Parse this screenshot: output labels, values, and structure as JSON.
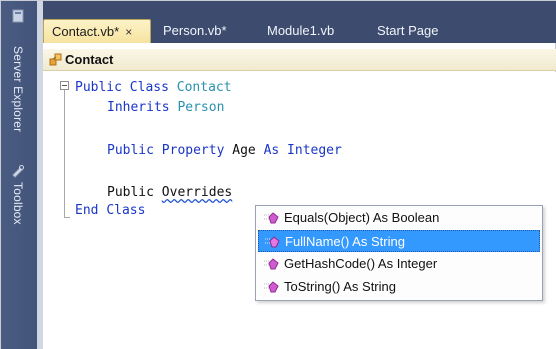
{
  "side_panel": {
    "items": [
      {
        "label": "Server Explorer",
        "icon": "server-explorer-icon"
      },
      {
        "label": "Toolbox",
        "icon": "toolbox-icon"
      }
    ]
  },
  "tabs": [
    {
      "label": "Contact.vb*",
      "active": true,
      "close": "×"
    },
    {
      "label": "Person.vb*",
      "active": false
    },
    {
      "label": "Module1.vb",
      "active": false
    },
    {
      "label": "Start Page",
      "active": false
    }
  ],
  "nav_bar": {
    "class_name": "Contact",
    "icon": "class-icon"
  },
  "code": {
    "line1": {
      "kw1": "Public",
      "kw2": "Class",
      "type": "Contact"
    },
    "line2": {
      "kw": "Inherits",
      "type": "Person"
    },
    "line3": {
      "kw1": "Public",
      "kw2": "Property",
      "name": "Age",
      "kw3": "As",
      "kw4": "Integer"
    },
    "line4": {
      "kw1": "Public",
      "squiggle": "Overrides"
    },
    "line5": {
      "kw1": "End",
      "kw2": "Class"
    }
  },
  "intellisense": {
    "items": [
      {
        "label": "Equals(Object) As Boolean",
        "icon": "method-icon",
        "selected": false
      },
      {
        "label": "FullName() As String",
        "icon": "method-icon",
        "selected": true
      },
      {
        "label": "GetHashCode() As Integer",
        "icon": "method-icon",
        "selected": false
      },
      {
        "label": "ToString() As String",
        "icon": "method-icon",
        "selected": false
      }
    ]
  },
  "colors": {
    "keyword": "#1a36c8",
    "type": "#2b91af",
    "selection": "#3399ff",
    "tab_strip": "#3c4b6e",
    "active_tab": "#fdf3c7"
  }
}
